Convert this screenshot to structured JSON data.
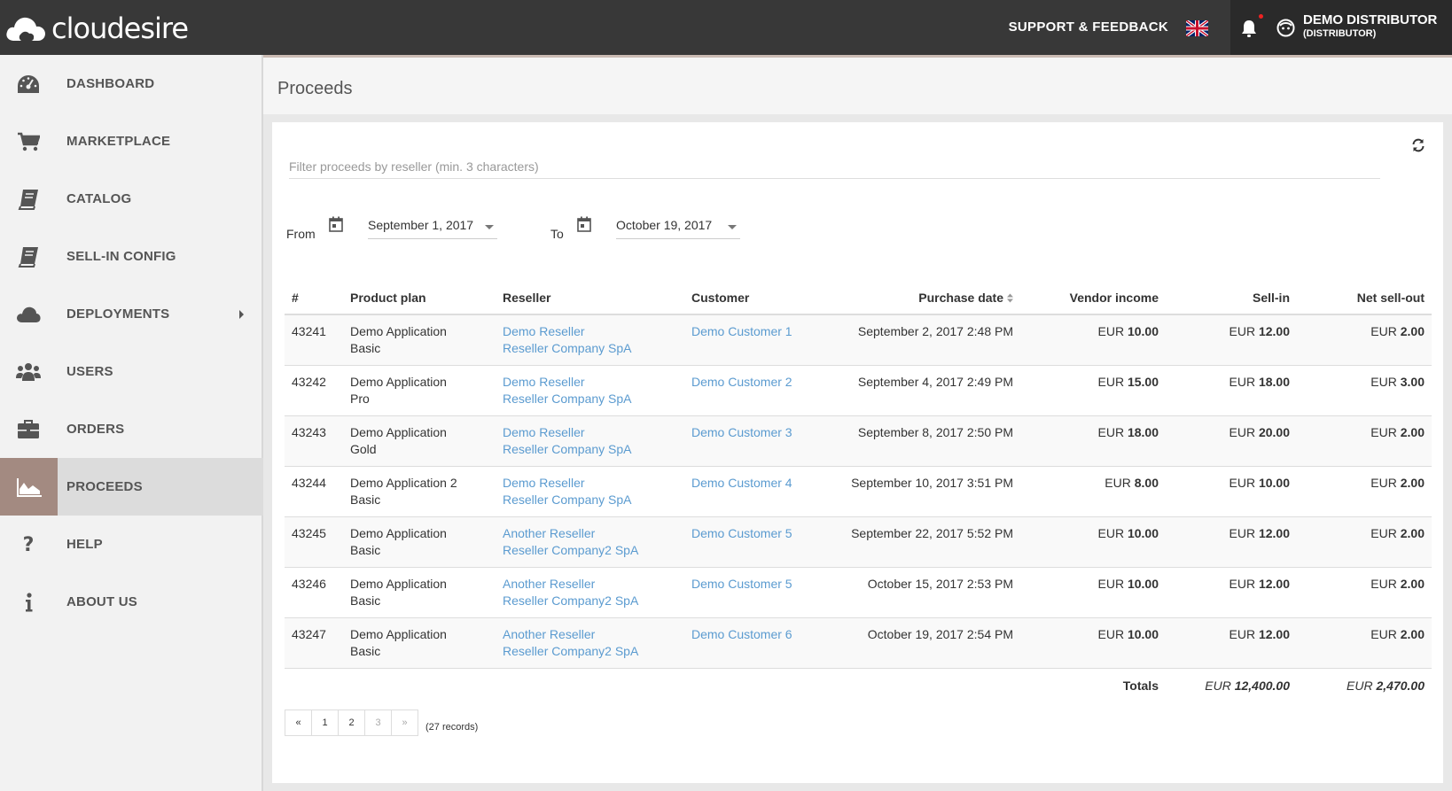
{
  "brand": {
    "name": "cloudesire"
  },
  "topbar": {
    "support_label": "SUPPORT & FEEDBACK",
    "user_name": "DEMO DISTRIBUTOR",
    "user_role": "(DISTRIBUTOR)"
  },
  "sidebar": {
    "items": [
      {
        "label": "DASHBOARD",
        "icon": "dashboard-icon"
      },
      {
        "label": "MARKETPLACE",
        "icon": "cart-icon"
      },
      {
        "label": "CATALOG",
        "icon": "book-icon"
      },
      {
        "label": "SELL-IN CONFIG",
        "icon": "book-icon"
      },
      {
        "label": "DEPLOYMENTS",
        "icon": "cloud-icon"
      },
      {
        "label": "USERS",
        "icon": "users-icon"
      },
      {
        "label": "ORDERS",
        "icon": "briefcase-icon"
      },
      {
        "label": "PROCEEDS",
        "icon": "area-chart-icon"
      },
      {
        "label": "HELP",
        "icon": "question-icon"
      },
      {
        "label": "ABOUT US",
        "icon": "info-icon"
      }
    ]
  },
  "page": {
    "title": "Proceeds",
    "filter_placeholder": "Filter proceeds by reseller (min. 3 characters)",
    "from_label": "From",
    "from_date": "September 1, 2017",
    "to_label": "To",
    "to_date": "October 19, 2017"
  },
  "table": {
    "headers": [
      "#",
      "Product plan",
      "Reseller",
      "Customer",
      "Purchase date",
      "Vendor income",
      "Sell-in",
      "Net sell-out"
    ],
    "rows": [
      {
        "id": "43241",
        "plan1": "Demo Application",
        "plan2": "Basic",
        "reseller": "Demo Reseller",
        "company": "Reseller Company SpA",
        "customer": "Demo Customer 1",
        "date": "September 2, 2017 2:48 PM",
        "vendor": "10.00",
        "sellin": "12.00",
        "netsellout": "2.00"
      },
      {
        "id": "43242",
        "plan1": "Demo Application",
        "plan2": "Pro",
        "reseller": "Demo Reseller",
        "company": "Reseller Company SpA",
        "customer": "Demo Customer 2",
        "date": "September 4, 2017 2:49 PM",
        "vendor": "15.00",
        "sellin": "18.00",
        "netsellout": "3.00"
      },
      {
        "id": "43243",
        "plan1": "Demo Application",
        "plan2": "Gold",
        "reseller": "Demo Reseller",
        "company": "Reseller Company SpA",
        "customer": "Demo Customer 3",
        "date": "September 8, 2017 2:50 PM",
        "vendor": "18.00",
        "sellin": "20.00",
        "netsellout": "2.00"
      },
      {
        "id": "43244",
        "plan1": "Demo Application 2",
        "plan2": "Basic",
        "reseller": "Demo Reseller",
        "company": "Reseller Company SpA",
        "customer": "Demo Customer 4",
        "date": "September 10, 2017 3:51 PM",
        "vendor": "8.00",
        "sellin": "10.00",
        "netsellout": "2.00"
      },
      {
        "id": "43245",
        "plan1": "Demo Application",
        "plan2": "Basic",
        "reseller": "Another Reseller",
        "company": "Reseller Company2 SpA",
        "customer": "Demo Customer 5",
        "date": "September 22, 2017 5:52 PM",
        "vendor": "10.00",
        "sellin": "12.00",
        "netsellout": "2.00"
      },
      {
        "id": "43246",
        "plan1": "Demo Application",
        "plan2": "Basic",
        "reseller": "Another Reseller",
        "company": "Reseller Company2 SpA",
        "customer": "Demo Customer 5",
        "date": "October 15, 2017 2:53 PM",
        "vendor": "10.00",
        "sellin": "12.00",
        "netsellout": "2.00"
      },
      {
        "id": "43247",
        "plan1": "Demo Application",
        "plan2": "Basic",
        "reseller": "Another Reseller",
        "company": "Reseller Company2 SpA",
        "customer": "Demo Customer 6",
        "date": "October 19, 2017 2:54 PM",
        "vendor": "10.00",
        "sellin": "12.00",
        "netsellout": "2.00"
      }
    ],
    "currency": "EUR",
    "totals_label": "Totals",
    "total_sellin": "12,400.00",
    "total_netsellout": "2,470.00"
  },
  "pagination": {
    "prev": "«",
    "pages": [
      "1",
      "2",
      "3"
    ],
    "next": "»",
    "records": "(27 records)"
  },
  "colors": {
    "topbar": "#383838",
    "active_icon_bg": "#a38a81",
    "link": "#5b9bd0"
  }
}
